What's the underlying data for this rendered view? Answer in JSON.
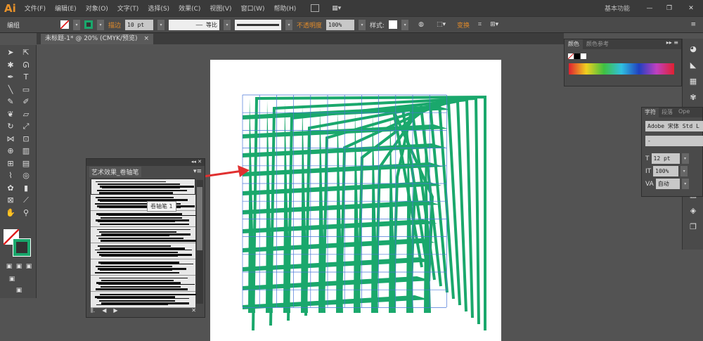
{
  "app": {
    "logo": "Ai",
    "workspace": "基本功能"
  },
  "menu": [
    "文件(F)",
    "编辑(E)",
    "对象(O)",
    "文字(T)",
    "选择(S)",
    "效果(C)",
    "视图(V)",
    "窗口(W)",
    "帮助(H)"
  ],
  "control": {
    "selection": "编组",
    "stroke_label": "描边",
    "stroke_value": "10 pt",
    "profile_label": "等比",
    "opacity_label": "不透明度",
    "opacity_value": "100%",
    "style_label": "样式:",
    "transform_label": "变换"
  },
  "document": {
    "tab": "未标题-1* @ 20% (CMYK/预览)"
  },
  "brush_panel": {
    "title": "艺术效果_卷轴笔",
    "tooltip": "卷轴笔 1"
  },
  "color_panel": {
    "tabs": [
      "颜色",
      "颜色参考"
    ]
  },
  "char_panel": {
    "tabs": [
      "字符",
      "段落",
      "Ope"
    ],
    "font": "Adobe 宋体 Std L",
    "style": "-",
    "size": "12 pt",
    "scale": "100%",
    "tracking": "自动"
  },
  "colors": {
    "art": "#1aa86c",
    "grid": "#4a78d8",
    "arrow": "#e03030"
  }
}
